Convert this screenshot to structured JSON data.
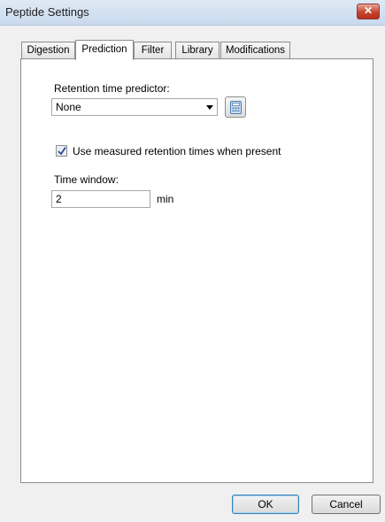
{
  "window": {
    "title": "Peptide Settings",
    "close_glyph": "✕"
  },
  "tabs": [
    {
      "label": "Digestion",
      "active": false
    },
    {
      "label": "Prediction",
      "active": true
    },
    {
      "label": "Filter",
      "active": false
    },
    {
      "label": "Library",
      "active": false
    },
    {
      "label": "Modifications",
      "active": false
    }
  ],
  "prediction": {
    "retention_label": "Retention time predictor:",
    "retention_value": "None",
    "calculator_icon": "calculator-icon",
    "use_measured_label": "Use measured retention times when present",
    "use_measured_checked": true,
    "time_window_label": "Time window:",
    "time_window_value": "2",
    "time_window_unit": "min"
  },
  "buttons": {
    "ok_label": "OK",
    "cancel_label": "Cancel"
  },
  "colors": {
    "titlebar": "#c9d9ee",
    "close_button": "#c7432f",
    "dialog_background": "#f0f0f0",
    "default_button_border": "#3c7fb1"
  }
}
